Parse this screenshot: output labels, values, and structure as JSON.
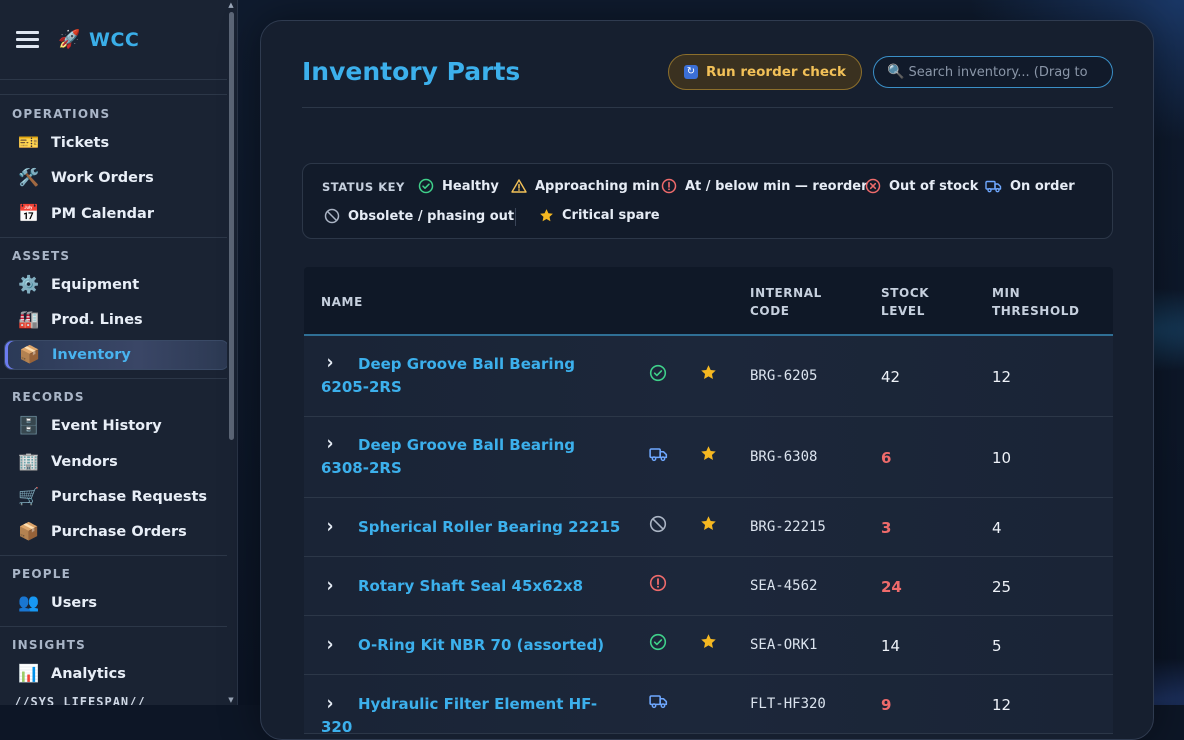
{
  "app": {
    "brand": "WCC",
    "brand_icon": "rocket-icon"
  },
  "sidebar": {
    "sections": [
      {
        "title": "OPERATIONS",
        "items": [
          {
            "label": "Tickets",
            "icon": "ticket-icon"
          },
          {
            "label": "Work Orders",
            "icon": "tools-icon"
          },
          {
            "label": "PM Calendar",
            "icon": "calendar-icon"
          }
        ]
      },
      {
        "title": "ASSETS",
        "items": [
          {
            "label": "Equipment",
            "icon": "gear-icon"
          },
          {
            "label": "Prod. Lines",
            "icon": "factory-icon"
          },
          {
            "label": "Inventory",
            "icon": "package-icon",
            "active": true
          }
        ]
      },
      {
        "title": "RECORDS",
        "items": [
          {
            "label": "Event History",
            "icon": "file-cabinet-icon"
          },
          {
            "label": "Vendors",
            "icon": "office-building-icon"
          },
          {
            "label": "Purchase Requests",
            "icon": "shopping-cart-icon"
          },
          {
            "label": "Purchase Orders",
            "icon": "package-icon"
          }
        ]
      },
      {
        "title": "PEOPLE",
        "items": [
          {
            "label": "Users",
            "icon": "users-icon"
          }
        ]
      },
      {
        "title": "INSIGHTS",
        "items": [
          {
            "label": "Analytics",
            "icon": "bar-chart-icon"
          }
        ]
      }
    ],
    "cutoff_text": "//SYS LIFESPAN//"
  },
  "main": {
    "title": "Inventory Parts",
    "reorder_button": {
      "label": "Run reorder check",
      "icon": "refresh-icon"
    },
    "search": {
      "placeholder": "Search inventory... (Drag to c",
      "icon": "search-icon"
    },
    "status_key": {
      "title": "STATUS KEY",
      "items": [
        {
          "label": "Healthy",
          "icon": "check-circle-icon",
          "color": "#3fd08a"
        },
        {
          "label": "Approaching min",
          "icon": "warning-triangle-icon",
          "color": "#f2c158"
        },
        {
          "label": "At / below min — reorder",
          "icon": "exclamation-circle-icon",
          "color": "#ef6b6b"
        },
        {
          "label": "Out of stock",
          "icon": "x-circle-icon",
          "color": "#ef6b6b"
        },
        {
          "label": "On order",
          "icon": "truck-icon",
          "color": "#6fa8ff"
        },
        {
          "label": "Obsolete / phasing out",
          "icon": "prohibited-icon",
          "color": "#aab4c4"
        },
        {
          "label": "Critical spare",
          "icon": "star-icon",
          "color": "#f5b821"
        }
      ]
    },
    "table": {
      "headers": {
        "name": "NAME",
        "code_line1": "INTERNAL",
        "code_line2": "CODE",
        "stock_line1": "STOCK",
        "stock_line2": "LEVEL",
        "min_line1": "MIN",
        "min_line2": "THRESHOLD"
      },
      "rows": [
        {
          "name": "Deep Groove Ball Bearing 6205-2RS",
          "status": "healthy",
          "critical": true,
          "code": "BRG-6205",
          "stock": "42",
          "stock_low": false,
          "min": "12"
        },
        {
          "name": "Deep Groove Ball Bearing 6308-2RS",
          "status": "on-order",
          "critical": true,
          "code": "BRG-6308",
          "stock": "6",
          "stock_low": true,
          "min": "10"
        },
        {
          "name": "Spherical Roller Bearing 22215",
          "status": "obsolete",
          "critical": true,
          "code": "BRG-22215",
          "stock": "3",
          "stock_low": true,
          "min": "4"
        },
        {
          "name": "Rotary Shaft Seal 45x62x8",
          "status": "reorder",
          "critical": false,
          "code": "SEA-4562",
          "stock": "24",
          "stock_low": true,
          "min": "25"
        },
        {
          "name": "O-Ring Kit NBR 70 (assorted)",
          "status": "healthy",
          "critical": true,
          "code": "SEA-ORK1",
          "stock": "14",
          "stock_low": false,
          "min": "5"
        },
        {
          "name": "Hydraulic Filter Element HF-320",
          "status": "on-order",
          "critical": false,
          "code": "FLT-HF320",
          "stock": "9",
          "stock_low": true,
          "min": "12"
        }
      ]
    }
  }
}
